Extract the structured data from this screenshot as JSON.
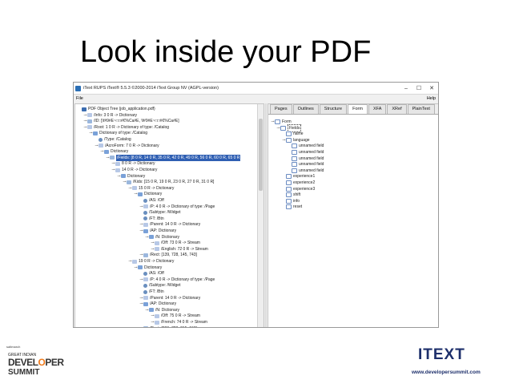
{
  "slide": {
    "title": "Look inside your PDF"
  },
  "window": {
    "title": "iText RUPS iText® 5.5.3 ©2000-2014 iText Group NV (AGPL-version)",
    "controls": {
      "minimize": "–",
      "maximize": "☐",
      "close": "✕"
    },
    "menu": {
      "file": "File",
      "help": "Help"
    }
  },
  "tree": [
    {
      "label": "PDF Object Tree (job_application.pdf)",
      "icon": "folder",
      "toggle": ""
    },
    {
      "label": "/Info: 3 0 R -> Dictionary",
      "icon": "ref",
      "toggle": "⊸"
    },
    {
      "label": "/ID: [\\f#9#E~□□#€%Ca#E, \\f#9#E~□□#€%Ca#E]",
      "icon": "arr",
      "toggle": "⊸"
    },
    {
      "label": "/Root: 1 0 R -> Dictionary of type: /Catalog",
      "icon": "ref",
      "toggle": "⊸"
    },
    {
      "label": "Dictionary of type: /Catalog",
      "icon": "dict",
      "toggle": "⊸"
    },
    {
      "label": "/Type: /Catalog",
      "icon": "name",
      "toggle": ""
    },
    {
      "label": "/AcroForm: 7 0 R -> Dictionary",
      "icon": "ref",
      "toggle": "⊸"
    },
    {
      "label": "Dictionary",
      "icon": "dict",
      "toggle": "⊸"
    },
    {
      "label": "/Fields: [8 0 R, 14 0 R, 35 0 R, 42 0 R, 49 0 R, 56 0 R, 60 0 R, 65 0 R",
      "icon": "arr",
      "toggle": "⊸",
      "highlight": true
    },
    {
      "label": "8 0 R -> Dictionary",
      "icon": "ref",
      "toggle": "⊸"
    },
    {
      "label": "14 0 R -> Dictionary",
      "icon": "ref",
      "toggle": "⊸"
    },
    {
      "label": "Dictionary",
      "icon": "dict",
      "toggle": "⊸"
    },
    {
      "label": "/Kids: [15 0 R, 19 0 R, 23 0 R, 27 0 R, 31 0 R]",
      "icon": "arr",
      "toggle": "⊸"
    },
    {
      "label": "15 0 R -> Dictionary",
      "icon": "ref",
      "toggle": "⊸"
    },
    {
      "label": "Dictionary",
      "icon": "dict",
      "toggle": "⊸"
    },
    {
      "label": "/AS: /Off",
      "icon": "name",
      "toggle": ""
    },
    {
      "label": "/P: 4 0 R -> Dictionary of type: /Page",
      "icon": "ref",
      "toggle": "⊸"
    },
    {
      "label": "/Subtype: /Widget",
      "icon": "name",
      "toggle": ""
    },
    {
      "label": "/FT: /Btn",
      "icon": "name",
      "toggle": ""
    },
    {
      "label": "/Parent: 14 0 R -> Dictionary",
      "icon": "ref",
      "toggle": "⊸"
    },
    {
      "label": "/AP: Dictionary",
      "icon": "dict",
      "toggle": "⊸"
    },
    {
      "label": "/N: Dictionary",
      "icon": "dict",
      "toggle": "⊸"
    },
    {
      "label": "/Off: 73 0 R -> Stream",
      "icon": "ref",
      "toggle": "⊸"
    },
    {
      "label": "/English: 72 0 R -> Stream",
      "icon": "ref",
      "toggle": "⊸"
    },
    {
      "label": "/Rect: [139, 728, 145, 743]",
      "icon": "arr",
      "toggle": "⊸"
    },
    {
      "label": "19 0 R -> Dictionary",
      "icon": "ref",
      "toggle": "⊸"
    },
    {
      "label": "Dictionary",
      "icon": "dict",
      "toggle": "⊸"
    },
    {
      "label": "/AS: /Off",
      "icon": "name",
      "toggle": ""
    },
    {
      "label": "/P: 4 0 R -> Dictionary of type: /Page",
      "icon": "ref",
      "toggle": "⊸"
    },
    {
      "label": "/Subtype: /Widget",
      "icon": "name",
      "toggle": ""
    },
    {
      "label": "/FT: /Btn",
      "icon": "name",
      "toggle": ""
    },
    {
      "label": "/Parent: 14 0 R -> Dictionary",
      "icon": "ref",
      "toggle": "⊸"
    },
    {
      "label": "/AP: Dictionary",
      "icon": "dict",
      "toggle": "⊸"
    },
    {
      "label": "/N: Dictionary",
      "icon": "dict",
      "toggle": "⊸"
    },
    {
      "label": "/Off: 75 0 R -> Stream",
      "icon": "ref",
      "toggle": "⊸"
    },
    {
      "label": "/French: 74 0 R -> Stream",
      "icon": "ref",
      "toggle": "⊸"
    },
    {
      "label": "/Rect: [209, 728, 215, 743]",
      "icon": "arr",
      "toggle": "⊸"
    }
  ],
  "tabs": [
    {
      "label": "Pages",
      "active": false
    },
    {
      "label": "Outlines",
      "active": false
    },
    {
      "label": "Structure",
      "active": false
    },
    {
      "label": "Form",
      "active": true
    },
    {
      "label": "XFA",
      "active": false
    },
    {
      "label": "XRef",
      "active": false
    },
    {
      "label": "PlainText",
      "active": false
    }
  ],
  "form_tree": [
    {
      "label": "Form",
      "icon": "field"
    },
    {
      "label": "Fields",
      "icon": "field",
      "selected": true
    },
    {
      "label": "name",
      "icon": "field"
    },
    {
      "label": "language",
      "icon": "field"
    },
    {
      "label": "unnamed field",
      "icon": "field"
    },
    {
      "label": "unnamed field",
      "icon": "field"
    },
    {
      "label": "unnamed field",
      "icon": "field"
    },
    {
      "label": "unnamed field",
      "icon": "field"
    },
    {
      "label": "unnamed field",
      "icon": "field"
    },
    {
      "label": "experience1",
      "icon": "field"
    },
    {
      "label": "experience2",
      "icon": "field"
    },
    {
      "label": "experience3",
      "icon": "field"
    },
    {
      "label": "shift",
      "icon": "field"
    },
    {
      "label": "info",
      "icon": "field"
    },
    {
      "label": "reset",
      "icon": "field"
    }
  ],
  "logos": {
    "left": {
      "brand": "saltmarch",
      "line1": "GREAT INDIAN",
      "line2": "DEVELOPER",
      "line3": "SUMMIT"
    },
    "right": {
      "brand": "ITEXT",
      "website": "www.developersummit.com"
    }
  },
  "colors": {
    "selection": "#2f5fb3",
    "brand_navy": "#1d2f6b",
    "dev_orange": "#f07a1a"
  }
}
